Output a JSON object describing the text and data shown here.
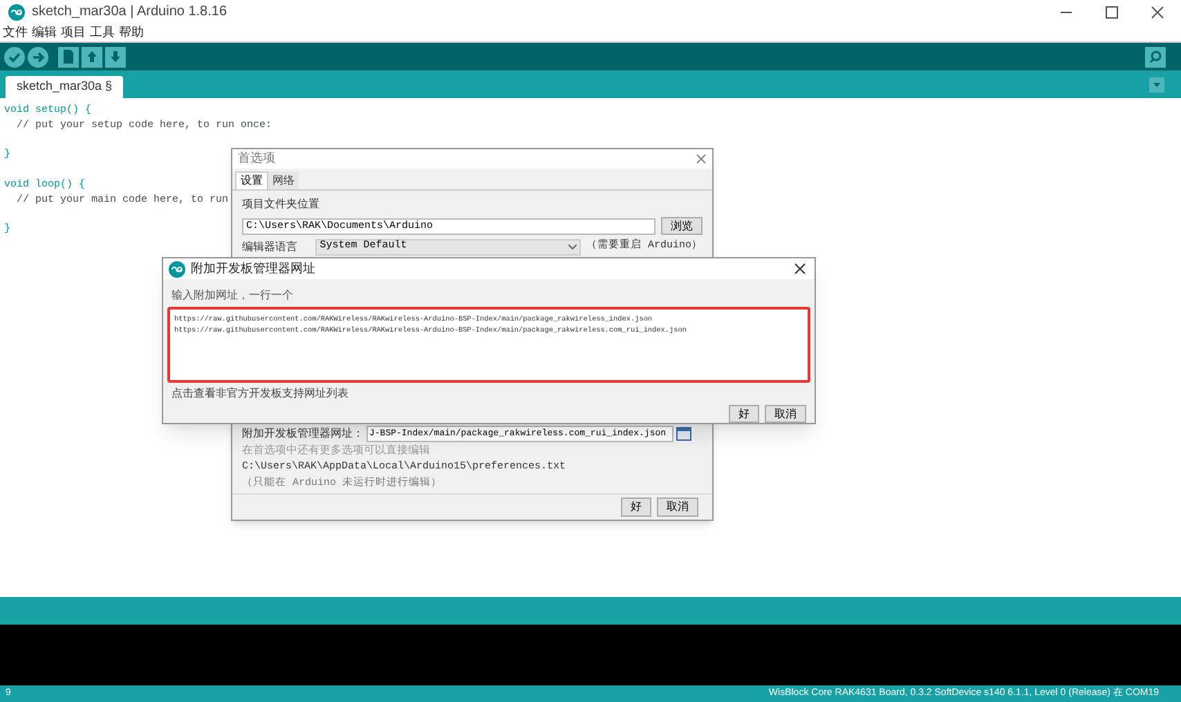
{
  "window": {
    "title": "sketch_mar30a | Arduino 1.8.16"
  },
  "menu": [
    "文件",
    "编辑",
    "项目",
    "工具",
    "帮助"
  ],
  "tabs": [
    {
      "label": "sketch_mar30a §",
      "selected": true
    }
  ],
  "editor": {
    "lines": [
      {
        "kind": "code",
        "text": "void setup() {"
      },
      {
        "kind": "comment",
        "text": "  // put your setup code here, to run once:"
      },
      {
        "kind": "blank"
      },
      {
        "kind": "code",
        "text": "}"
      },
      {
        "kind": "blank"
      },
      {
        "kind": "code",
        "text": "void loop() {"
      },
      {
        "kind": "comment",
        "text": "  // put your main code here, to run"
      },
      {
        "kind": "blank"
      },
      {
        "kind": "code",
        "text": "}"
      }
    ]
  },
  "preferences": {
    "title": "首选项",
    "tabs": [
      {
        "label": "设置",
        "selected": true
      },
      {
        "label": "网络",
        "selected": false
      }
    ],
    "sketchbook_label": "项目文件夹位置",
    "sketchbook_path": "C:\\Users\\RAK\\Documents\\Arduino",
    "browse_button": "浏览",
    "language_label": "编辑器语言",
    "language_value": "System Default",
    "language_note": "（需要重启 Arduino）",
    "board_urls_label": "附加开发板管理器网址：",
    "board_urls_value": "J-BSP-Index/main/package_rakwireless.com_rui_index.json",
    "more_prefs_note": "在首选项中还有更多选项可以直接编辑",
    "prefs_path": "C:\\Users\\RAK\\AppData\\Local\\Arduino15\\preferences.txt",
    "edit_note": "（只能在 Arduino 未运行时进行编辑）",
    "buttons": [
      "好",
      "取消"
    ]
  },
  "board_urls_dialog": {
    "title": "附加开发板管理器网址",
    "prompt": "输入附加网址，一行一个",
    "urls": [
      "https://raw.githubusercontent.com/RAKWireless/RAKwireless-Arduino-BSP-Index/main/package_rakwireless_index.json",
      "https://raw.githubusercontent.com/RAKWireless/RAKwireless-Arduino-BSP-Index/main/package_rakwireless.com_rui_index.json"
    ],
    "link": "点击查看非官方开发板支持网址列表",
    "buttons": [
      "好",
      "取消"
    ]
  },
  "status_bar": {
    "line": "9",
    "board": "WisBlock Core RAK4631 Board, 0.3.2 SoftDevice s140 6.1.1, Level 0 (Release) 在 COM19"
  }
}
